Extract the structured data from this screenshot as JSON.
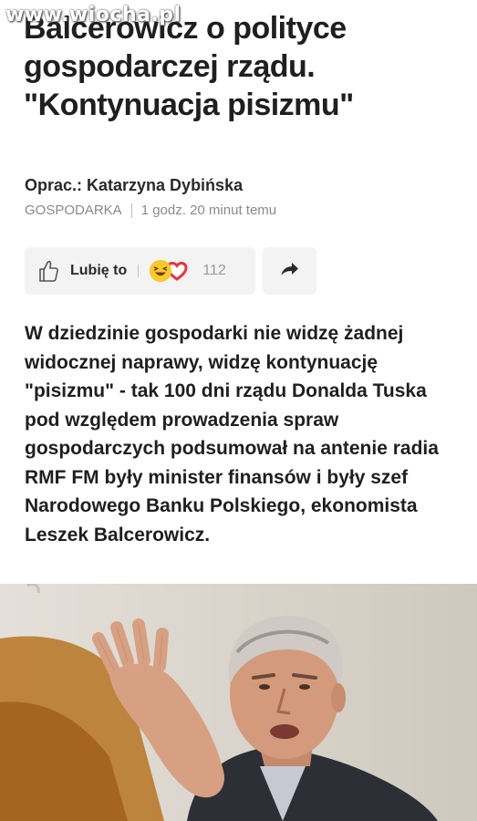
{
  "watermark": "www.wiocha.pl",
  "article": {
    "title": "Balcerowicz o polityce gospodarczej rządu. \"Kontynuacja pisizmu\"",
    "author": "Oprac.: Katarzyna Dybińska",
    "category": "GOSPODARKA",
    "time": "1 godz. 20 minut temu",
    "lead": "W dziedzinie gospodarki nie widzę żadnej widocznej naprawy, widzę kontynuację \"pisizmu\" - tak 100 dni rządu Donalda Tuska pod względem prowadzenia spraw gospodarczych podsumował na antenie radia RMF FM były minister finansów i były szef Narodowego Banku Polskiego, ekonomista Leszek Balcerowicz."
  },
  "reactions": {
    "like_label": "Lubię to",
    "count": "112",
    "icons": [
      "thumbs-up-icon",
      "laughing-face-icon",
      "heart-icon",
      "share-arrow-icon"
    ]
  },
  "photo": {
    "subject": "Leszek Balcerowicz"
  }
}
